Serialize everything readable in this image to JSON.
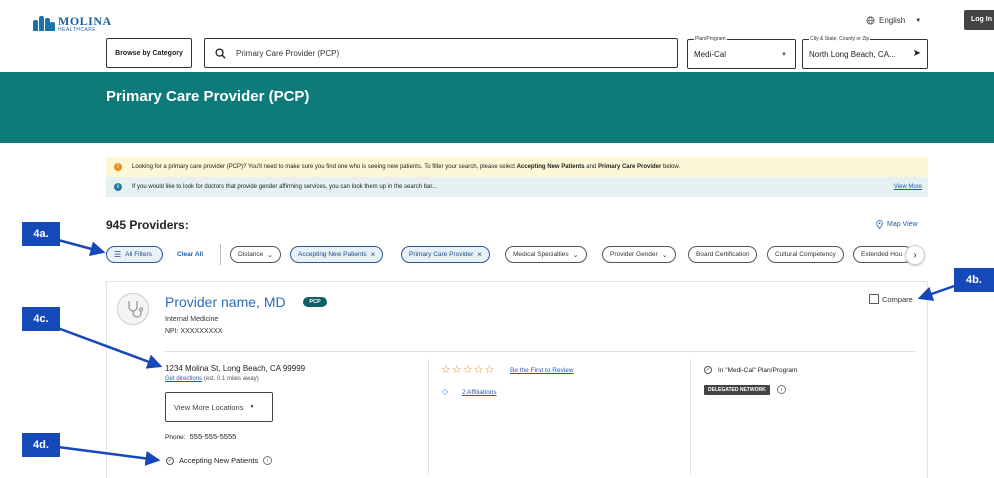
{
  "header": {
    "logo_brand": "MOLINA",
    "logo_sub": "HEALTHCARE",
    "language": "English",
    "login_label": "Log In",
    "browse_label": "Browse by Category",
    "search_value": "Primary Care Provider (PCP)",
    "plan_legend": "Plan/Program",
    "plan_value": "Medi-Cal",
    "city_legend": "City & State, County or Zip",
    "city_value": "North Long Beach, CA..."
  },
  "banner": {
    "title": "Primary Care Provider (PCP)"
  },
  "alerts": {
    "warning_text_1": "Looking for a primary care provider (PCP)? You'll need to make sure you find one who is seeing new patients. To filter your search, please select ",
    "warning_bold_1": "Accepting New Patients",
    "warning_text_2": " and ",
    "warning_bold_2": "Primary Care Provider",
    "warning_text_3": " below.",
    "info_text": "If you would like to look for doctors that provide gender affirming services, you can look them up in the search bar...",
    "view_more": "View More"
  },
  "results": {
    "count_label": "945 Providers:",
    "map_view": "Map View"
  },
  "filters": {
    "all_filters": "All Filters",
    "clear_all": "Clear All",
    "chips": [
      "Distance",
      "Accepting New Patients",
      "Primary Care Provider",
      "Medical Specialties",
      "Provider Gender",
      "Board Certification",
      "Cultural Competency",
      "Extended Hou"
    ]
  },
  "provider": {
    "name": "Provider name, MD",
    "badge": "PCP",
    "specialty": "Internal Medicine",
    "npi": "NPI: XXXXXXXXX",
    "compare": "Compare",
    "address": "1234 Molina St, Long Beach, CA 99999",
    "directions_link": "Get directions",
    "directions_distance": "(est. 0.1 miles away)",
    "more_locations": "View More Locations",
    "phone_label": "Phone:",
    "phone": "555-555-5555",
    "accepting": "Accepting New Patients",
    "stars": "☆☆☆☆☆",
    "review_link": "Be the First to Review",
    "affiliations": "2 Affiliations",
    "plan_line": "In \"Medi-Cal\" Plan/Program",
    "delegated": "DELEGATED NETWORK"
  },
  "callouts": {
    "a": "4a.",
    "b": "4b.",
    "c": "4c.",
    "d": "4d."
  },
  "colors": {
    "banner": "#0f7a7a",
    "callout": "#1548b8",
    "link": "#1a5fb4",
    "star": "#e08a24"
  }
}
